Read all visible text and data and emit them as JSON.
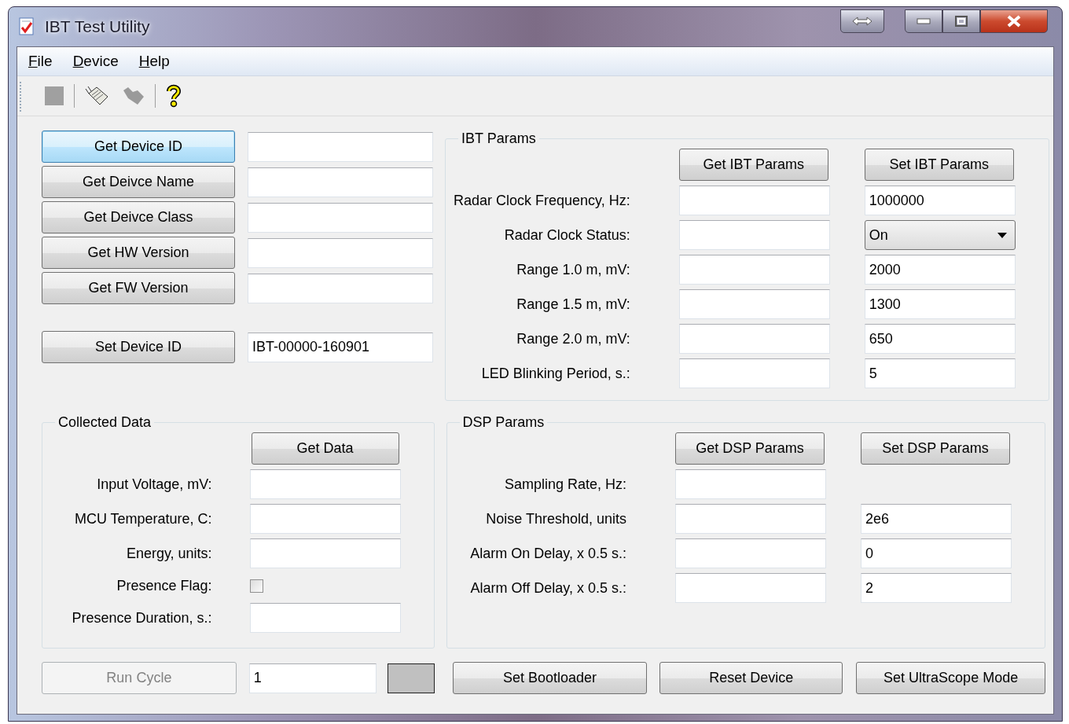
{
  "window": {
    "title": "IBT Test Utility"
  },
  "menu": [
    {
      "label": "File"
    },
    {
      "label": "Device"
    },
    {
      "label": "Help"
    }
  ],
  "toolbar": [
    {
      "kind": "stop",
      "disabled": true
    },
    {
      "kind": "separator"
    },
    {
      "kind": "connect",
      "disabled": false
    },
    {
      "kind": "disconnect",
      "disabled": true
    },
    {
      "kind": "separator"
    },
    {
      "kind": "help",
      "disabled": false
    }
  ],
  "device_commands": [
    {
      "button": "Get Device ID",
      "focused": true
    },
    {
      "button": "Get Deivce Name",
      "focused": false
    },
    {
      "button": "Get Deivce Class",
      "focused": false
    },
    {
      "button": "Get HW Version",
      "focused": false
    },
    {
      "button": "Get FW Version",
      "focused": false
    }
  ],
  "set_device_id": {
    "button": "Set Device ID",
    "value": "IBT-00000-160901"
  },
  "collected_data": {
    "title": "Collected Data",
    "button": "Get Data",
    "fields": [
      {
        "kind": "text",
        "label": "Input Voltage, mV:"
      },
      {
        "kind": "text",
        "label": "MCU Temperature, C:"
      },
      {
        "kind": "text",
        "label": "Energy, units:"
      },
      {
        "kind": "checkbox",
        "label": "Presence Flag:",
        "checked": false
      },
      {
        "kind": "text",
        "label": "Presence Duration, s.:"
      }
    ]
  },
  "ibt_params": {
    "title": "IBT Params",
    "get_button": "Get IBT Params",
    "set_button": "Set IBT Params",
    "rows": [
      {
        "kind": "text",
        "label": "Radar Clock Frequency, Hz:",
        "set_value": "1000000"
      },
      {
        "kind": "dropdown",
        "label": "Radar Clock Status:",
        "set_value": "On"
      },
      {
        "kind": "text",
        "label": "Range 1.0 m, mV:",
        "set_value": "2000"
      },
      {
        "kind": "text",
        "label": "Range 1.5 m, mV:",
        "set_value": "1300"
      },
      {
        "kind": "text",
        "label": "Range 2.0 m, mV:",
        "set_value": "650"
      },
      {
        "kind": "text",
        "label": "LED Blinking Period, s.:",
        "set_value": "5"
      }
    ]
  },
  "dsp_params": {
    "title": "DSP Params",
    "get_button": "Get DSP Params",
    "set_button": "Set DSP Params",
    "rows": [
      {
        "kind": "readonly",
        "label": "Sampling Rate, Hz:"
      },
      {
        "kind": "text",
        "label": "Noise Threshold, units",
        "set_value": "2e6"
      },
      {
        "kind": "text",
        "label": "Alarm On Delay, x 0.5 s.:",
        "set_value": "0"
      },
      {
        "kind": "text",
        "label": "Alarm Off Delay, x 0.5 s.:",
        "set_value": "2"
      }
    ]
  },
  "footer": {
    "run_cycle": {
      "label": "Run Cycle",
      "disabled": true
    },
    "cycle_count": "1",
    "indicator": {
      "color": "#c0c0c0"
    },
    "buttons": [
      "Set Bootloader",
      "Reset Device",
      "Set UltraScope Mode"
    ]
  }
}
